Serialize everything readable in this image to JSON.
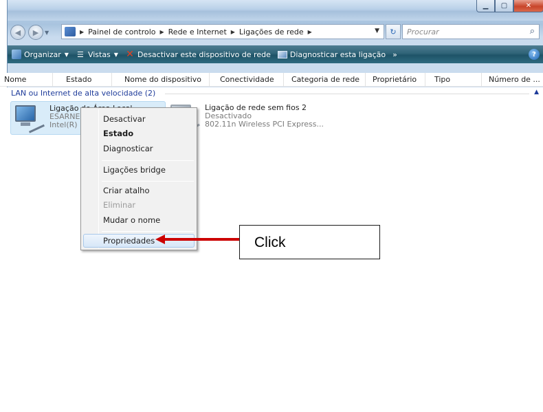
{
  "address_bar": {
    "breadcrumbs": [
      "Painel de controlo",
      "Rede e Internet",
      "Ligações de rede"
    ],
    "search_placeholder": "Procurar"
  },
  "toolbar": {
    "organize": "Organizar",
    "views": "Vistas",
    "disable_device": "Desactivar este dispositivo de rede",
    "diagnose": "Diagnosticar esta ligação",
    "more": "»"
  },
  "columns": [
    "Nome",
    "Estado",
    "Nome do dispositivo",
    "Conectividade",
    "Categoria de rede",
    "Proprietário",
    "Tipo",
    "Número de ..."
  ],
  "group": {
    "title": "LAN ou Internet de alta velocidade (2)"
  },
  "items": [
    {
      "name": "Ligação de Área Local",
      "status": "ESARNE",
      "device": "Intel(R)"
    },
    {
      "name": "Ligação de rede sem fios 2",
      "status": "Desactivado",
      "device": "802.11n Wireless PCI Express..."
    }
  ],
  "context_menu": {
    "items": [
      "Desactivar",
      "Estado",
      "Diagnosticar",
      "Ligações bridge",
      "Criar atalho",
      "Eliminar",
      "Mudar o nome",
      "Propriedades"
    ]
  },
  "callout": {
    "text": "Click"
  },
  "colors": {
    "toolbar": "#2f6377",
    "group_title": "#1e3b9a",
    "arrow": "#cc0000"
  }
}
